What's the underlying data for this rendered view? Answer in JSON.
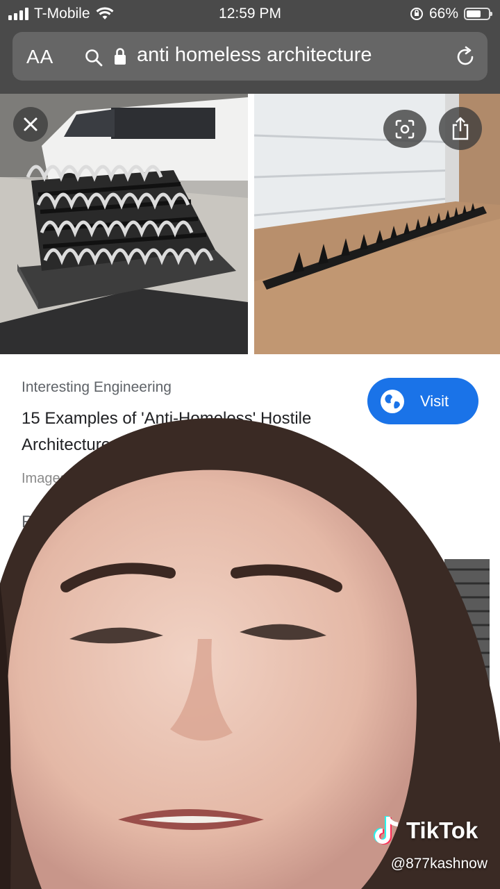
{
  "status_bar": {
    "carrier": "T-Mobile",
    "time": "12:59 PM",
    "battery_pct": "66%"
  },
  "browser": {
    "text_size_label": "AA",
    "url_text": "anti homeless architecture"
  },
  "result": {
    "source": "Interesting Engineering",
    "title": "15 Examples of 'Anti-Homeless' Hostile Architecture",
    "visit_label": "Visit",
    "image_note": "Images may be subject to copyright.",
    "related_heading": "Related"
  },
  "overlay": {
    "brand": "TikTok",
    "handle": "@877kashnow"
  },
  "icons": [
    "wifi-icon",
    "lock-rotation-icon",
    "search-icon",
    "lock-icon",
    "reload-icon",
    "close-icon",
    "lens-icon",
    "share-icon",
    "globe-icon",
    "tiktok-logo-icon"
  ],
  "colors": {
    "accent": "#1a73e8",
    "chrome": "#4a4a4a"
  }
}
